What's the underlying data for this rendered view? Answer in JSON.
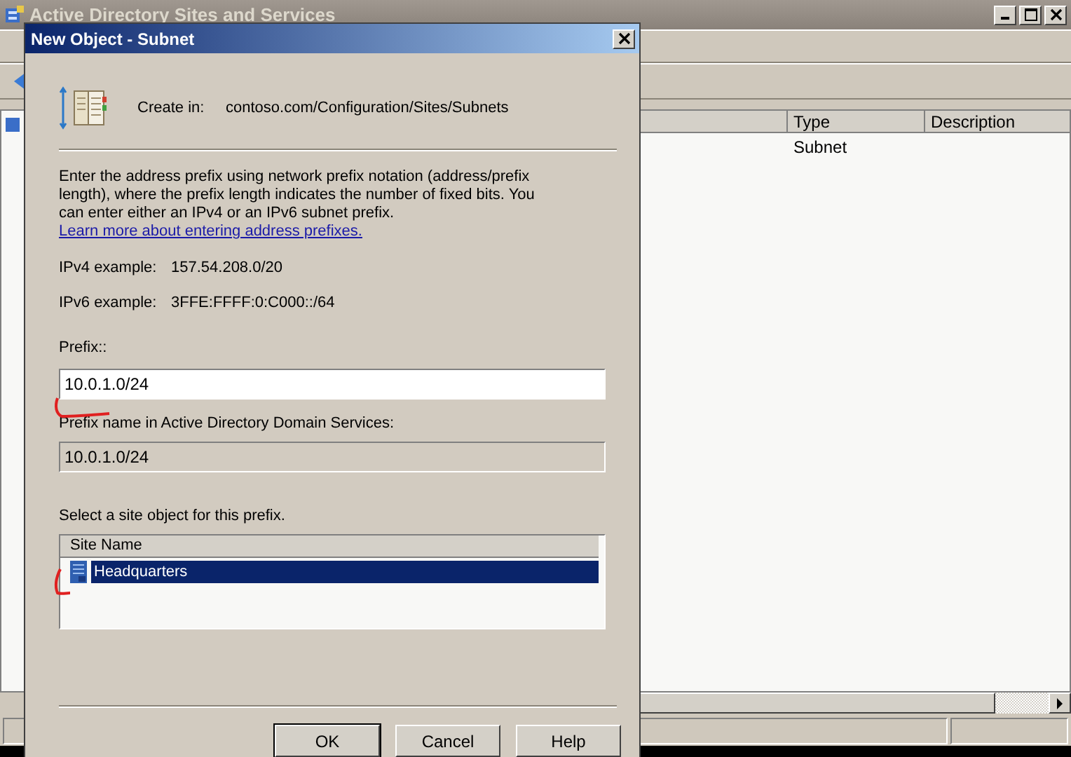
{
  "main_window": {
    "title": "Active Directory Sites and Services",
    "columns": [
      {
        "label": "Type"
      },
      {
        "label": "Description"
      }
    ],
    "rows": [
      {
        "type": "Subnet"
      }
    ]
  },
  "dialog": {
    "title": "New Object - Subnet",
    "create_in_label": "Create in:",
    "create_in_path": "contoso.com/Configuration/Sites/Subnets",
    "description": "Enter the address prefix using network prefix notation (address/prefix length), where the prefix length indicates the number of fixed bits. You can enter either an IPv4 or an IPv6 subnet prefix.",
    "link": "Learn more about entering address prefixes.",
    "examples": [
      {
        "label": "IPv4 example:",
        "value": "157.54.208.0/20"
      },
      {
        "label": "IPv6 example:",
        "value": "3FFE:FFFF:0:C000::/64"
      }
    ],
    "prefix_label": "Prefix::",
    "prefix_value": "10.0.1.0/24",
    "prefix_name_label": "Prefix name in Active Directory Domain Services:",
    "prefix_name_value": "10.0.1.0/24",
    "site_label": "Select a site object for this prefix.",
    "site_column": "Site Name",
    "sites": [
      {
        "name": "Headquarters",
        "selected": true
      }
    ],
    "buttons": [
      {
        "label": "OK",
        "default": true
      },
      {
        "label": "Cancel",
        "default": false
      },
      {
        "label": "Help",
        "default": false
      }
    ]
  }
}
